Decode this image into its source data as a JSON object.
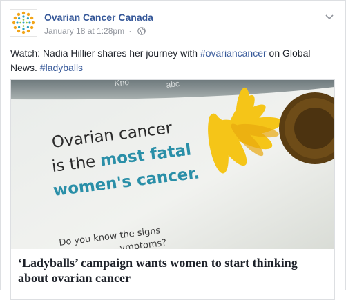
{
  "post": {
    "page_name": "Ovarian Cancer Canada",
    "timestamp": "January 18 at 1:28pm",
    "separator": "·",
    "privacy_icon": "globe-icon",
    "menu_icon": "chevron-down-icon",
    "avatar_icon": "ovarian-cancer-canada-logo",
    "caption": {
      "prefix": "Watch: Nadia Hillier shares her journey with ",
      "hashtag1": "#ovariancancer",
      "middle": " on Global News. ",
      "hashtag2": "#ladyballs"
    }
  },
  "link_card": {
    "image": {
      "line1": "Ovarian cancer",
      "line2_a": "is the ",
      "line2_b": "most fatal",
      "line3": "women's cancer.",
      "bottom_1": "Do you know the signs",
      "bottom_2": "ymptoms?"
    },
    "title": "‘Ladyballs’ campaign wants women to start thinking about ovarian cancer"
  },
  "colors": {
    "link_blue": "#365899",
    "text_dark": "#1d2129",
    "meta_gray": "#90949c",
    "teal": "#2a8fa8",
    "sunflower_yellow": "#f2c21a"
  }
}
